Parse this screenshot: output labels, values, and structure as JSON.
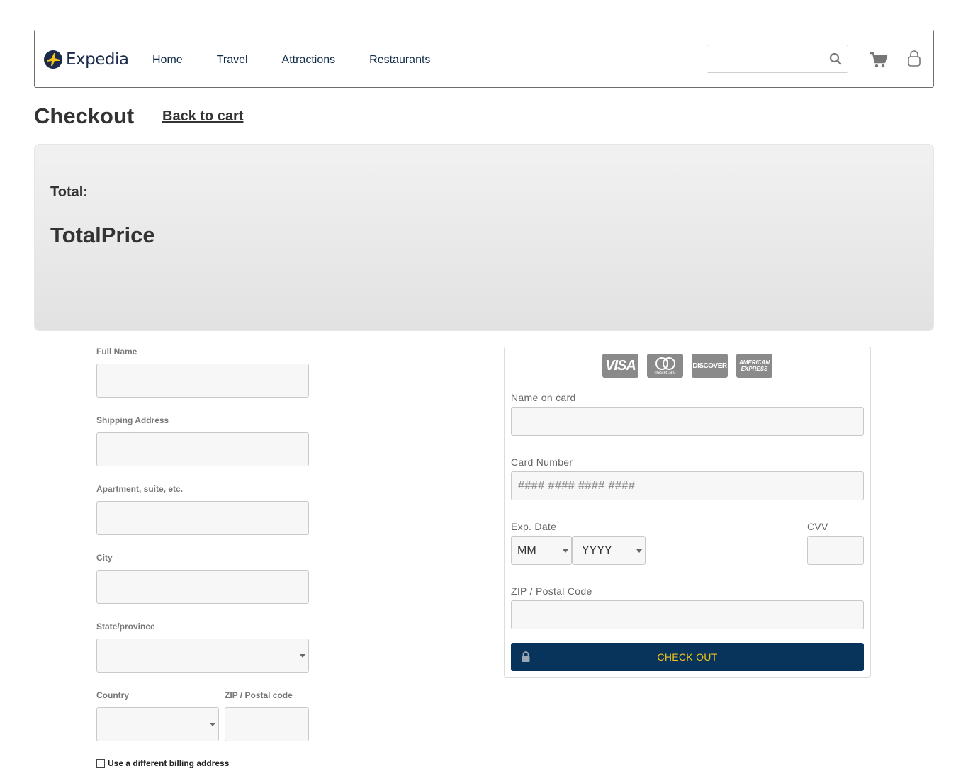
{
  "header": {
    "brand": "Expedia",
    "nav": [
      "Home",
      "Travel",
      "Attractions",
      "Restaurants"
    ],
    "search": {
      "value": "",
      "placeholder": ""
    },
    "icons": {
      "search": "search-icon",
      "cart": "cart-icon",
      "user": "user-icon",
      "logo": "plane-globe-logo"
    }
  },
  "page": {
    "title": "Checkout",
    "back_link": "Back to cart"
  },
  "summary": {
    "total_label": "Total:",
    "total_value": "TotalPrice"
  },
  "shipping": {
    "full_name": {
      "label": "Full Name",
      "value": ""
    },
    "address": {
      "label": "Shipping Address",
      "value": ""
    },
    "apartment": {
      "label": "Apartment, suite, etc.",
      "value": ""
    },
    "city": {
      "label": "City",
      "value": ""
    },
    "state": {
      "label": "State/province",
      "value": ""
    },
    "country": {
      "label": "Country",
      "value": ""
    },
    "zip": {
      "label": "ZIP / Postal code",
      "value": ""
    },
    "billing_checkbox": {
      "label": "Use a different billing address",
      "checked": false
    }
  },
  "payment": {
    "card_logos": [
      "VISA",
      "mastercard",
      "DISCOVER",
      "AMERICAN EXPRESS"
    ],
    "name_on_card": {
      "label": "Name on card",
      "value": ""
    },
    "card_number": {
      "label": "Card Number",
      "placeholder": "#### #### #### ####",
      "value": ""
    },
    "exp_date": {
      "label": "Exp. Date",
      "month": "MM",
      "year": "YYYY"
    },
    "cvv": {
      "label": "CVV",
      "value": ""
    },
    "zip": {
      "label": "ZIP / Postal Code",
      "value": ""
    },
    "checkout_button": "CHECK OUT"
  },
  "colors": {
    "brand_navy": "#08345c",
    "button_text": "#f2c21a",
    "nav_text": "#0f2a4a",
    "logo_yellow": "#f8c51c"
  }
}
